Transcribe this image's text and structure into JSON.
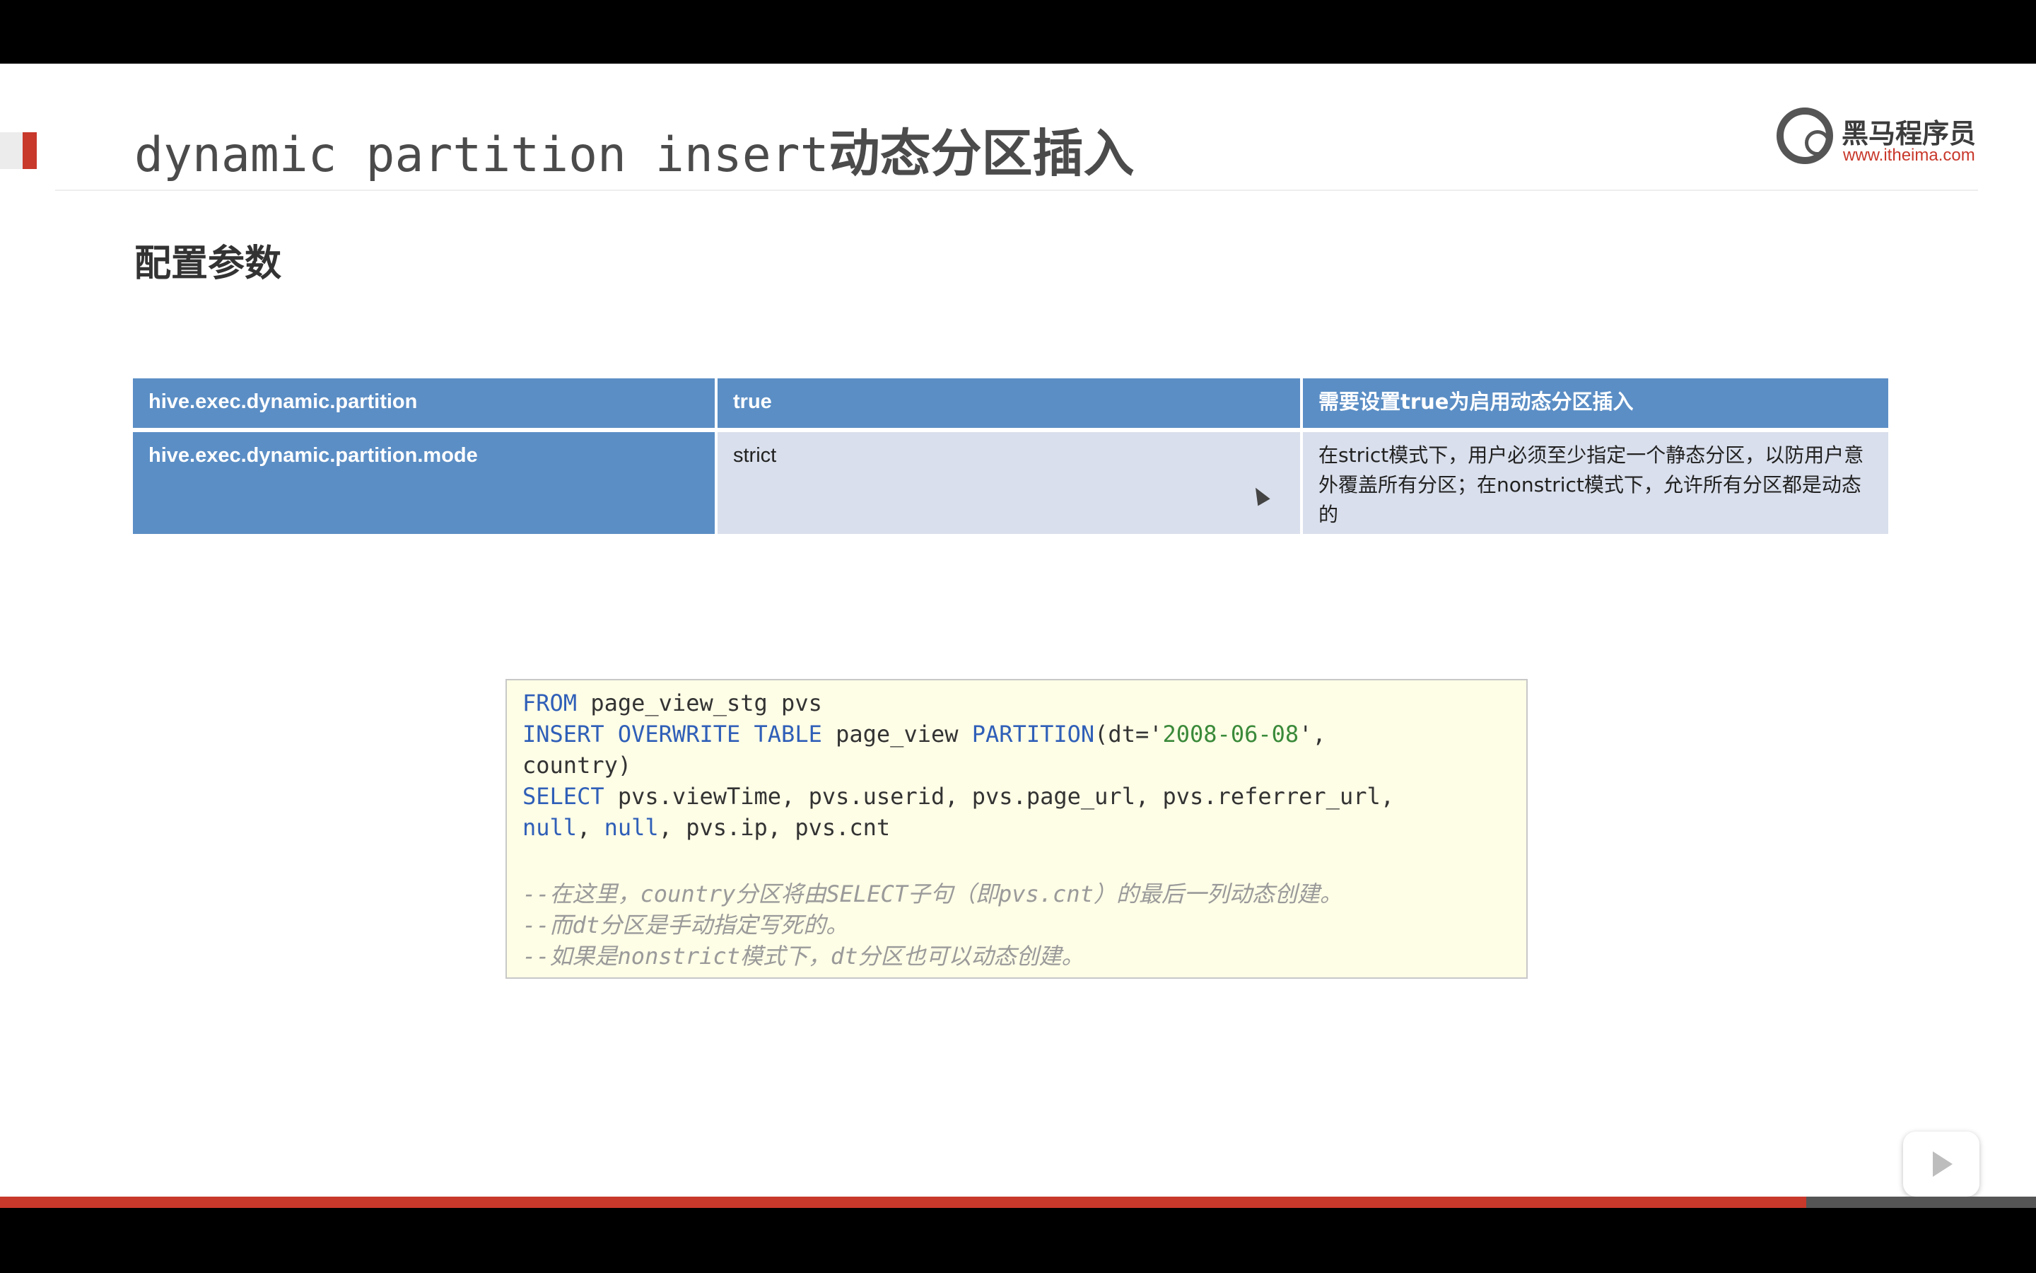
{
  "slide": {
    "title_en": "dynamic partition insert",
    "title_cn": "动态分区插入",
    "subtitle": "配置参数"
  },
  "logo": {
    "brand": "黑马程序员",
    "url": "www.itheima.com"
  },
  "table": {
    "rows": [
      {
        "name": "hive.exec.dynamic.partition",
        "value": "true",
        "desc": "需要设置true为启用动态分区插入"
      },
      {
        "name": "hive.exec.dynamic.partition.mode",
        "value": "strict",
        "desc": "在strict模式下，用户必须至少指定一个静态分区，以防用户意外覆盖所有分区；在nonstrict模式下，允许所有分区都是动态的"
      }
    ]
  },
  "code": {
    "l1_kw": "FROM",
    "l1_rest": " page_view_stg pvs",
    "l2_kw1": "INSERT OVERWRITE TABLE",
    "l2_mid": " page_view ",
    "l2_kw2": "PARTITION",
    "l2_pre": "(dt='",
    "l2_str": "2008-06-08",
    "l2_post": "',",
    "l3": "country)",
    "l4_kw": "SELECT",
    "l4_rest": " pvs.viewTime, pvs.userid, pvs.page_url, pvs.referrer_url,",
    "l5_kw1": "null",
    "l5_sep": ", ",
    "l5_kw2": "null",
    "l5_rest": ", pvs.ip, pvs.cnt",
    "c1": "--在这里，country分区将由SELECT子句（即pvs.cnt）的最后一列动态创建。",
    "c2": "--而dt分区是手动指定写死的。",
    "c3": "--如果是nonstrict模式下，dt分区也可以动态创建。"
  },
  "player": {
    "progress": 0.887,
    "nav_icons": [
      "prev-icon",
      "next-icon",
      "pen-icon",
      "slides-icon",
      "zoom-icon",
      "more-icon"
    ]
  }
}
